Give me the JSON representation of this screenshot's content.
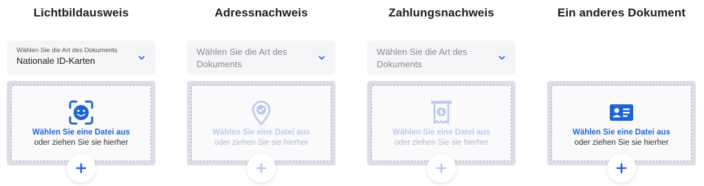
{
  "colors": {
    "accent": "#1d64d6",
    "accent_disabled": "#b9c9ee",
    "dropzone_bg": "#dddde8",
    "select_bg": "#f5f5f7"
  },
  "columns": [
    {
      "title": "Lichtbildausweis",
      "select": {
        "label": "Wählen Sie die Art des Dokuments",
        "value": "Nationale ID-Karten"
      },
      "dropzone": {
        "icon": "face-scan-icon",
        "line1": "Wählen Sie eine Datei aus",
        "line2": "oder ziehen Sie sie hierher",
        "state": "enabled"
      },
      "add_icon": "plus-icon"
    },
    {
      "title": "Adressnachweis",
      "select": {
        "placeholder": "Wählen Sie die Art des Dokuments"
      },
      "dropzone": {
        "icon": "location-check-icon",
        "line1": "Wählen Sie eine Datei aus",
        "line2": "oder ziehen Sie sie hierher",
        "state": "disabled"
      },
      "add_icon": "plus-icon"
    },
    {
      "title": "Zahlungsnachweis",
      "select": {
        "placeholder": "Wählen Sie die Art des Dokuments"
      },
      "dropzone": {
        "icon": "receipt-dollar-icon",
        "line1": "Wählen Sie eine Datei aus",
        "line2": "oder ziehen Sie sie hierher",
        "state": "disabled"
      },
      "add_icon": "plus-icon"
    },
    {
      "title": "Ein anderes Dokument",
      "dropzone": {
        "icon": "id-card-icon",
        "line1": "Wählen Sie eine Datei aus",
        "line2": "oder ziehen Sie sie hierher",
        "state": "enabled"
      },
      "add_icon": "plus-icon"
    }
  ]
}
